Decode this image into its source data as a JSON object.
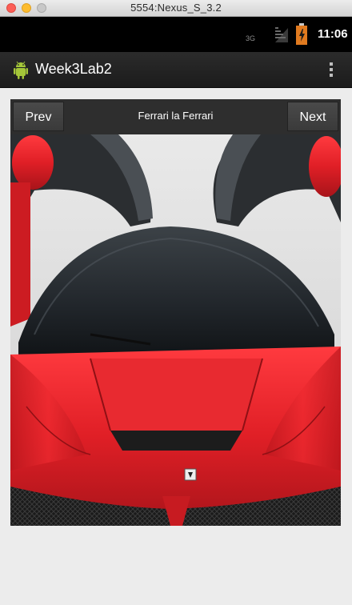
{
  "window": {
    "title": "5554:Nexus_S_3.2"
  },
  "status_bar": {
    "network": "3G",
    "time": "11:06"
  },
  "action_bar": {
    "app_title": "Week3Lab2",
    "icon": "android-robot-icon",
    "overflow_icon": "overflow-menu-icon"
  },
  "viewer": {
    "prev_label": "Prev",
    "next_label": "Next",
    "caption": "Ferrari la Ferrari",
    "image": "red-sports-car-front-view"
  },
  "colors": {
    "car_red": "#e01f26",
    "action_bar": "#222222",
    "status_bar": "#000000"
  }
}
